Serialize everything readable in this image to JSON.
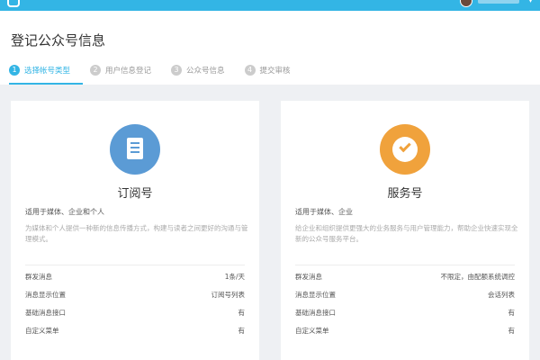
{
  "page": {
    "title": "登记公众号信息"
  },
  "steps": [
    {
      "num": "1",
      "label": "选择帐号类型"
    },
    {
      "num": "2",
      "label": "用户信息登记"
    },
    {
      "num": "3",
      "label": "公众号信息"
    },
    {
      "num": "4",
      "label": "提交审核"
    }
  ],
  "cards": [
    {
      "title": "订阅号",
      "for": "适用于媒体、企业和个人",
      "desc": "为媒体和个人提供一种新的信息传播方式，构建与读者之间更好的沟通与管理模式。",
      "icon_color": "#5b9bd5",
      "features": [
        {
          "label": "群发消息",
          "value": "1条/天"
        },
        {
          "label": "消息显示位置",
          "value": "订阅号列表"
        },
        {
          "label": "基础消息接口",
          "value": "有"
        },
        {
          "label": "自定义菜单",
          "value": "有"
        }
      ]
    },
    {
      "title": "服务号",
      "for": "适用于媒体、企业",
      "desc": "给企业和组织提供更强大的业务服务与用户管理能力，帮助企业快速实现全新的公众号服务平台。",
      "icon_color": "#f0a23c",
      "features": [
        {
          "label": "群发消息",
          "value": "不限定，由配额系统调控"
        },
        {
          "label": "消息显示位置",
          "value": "会话列表"
        },
        {
          "label": "基础消息接口",
          "value": "有"
        },
        {
          "label": "自定义菜单",
          "value": "有"
        }
      ]
    }
  ],
  "colors": {
    "accent": "#33b5e5",
    "subscription_icon": "#5b9bd5",
    "service_icon": "#f0a23c"
  }
}
